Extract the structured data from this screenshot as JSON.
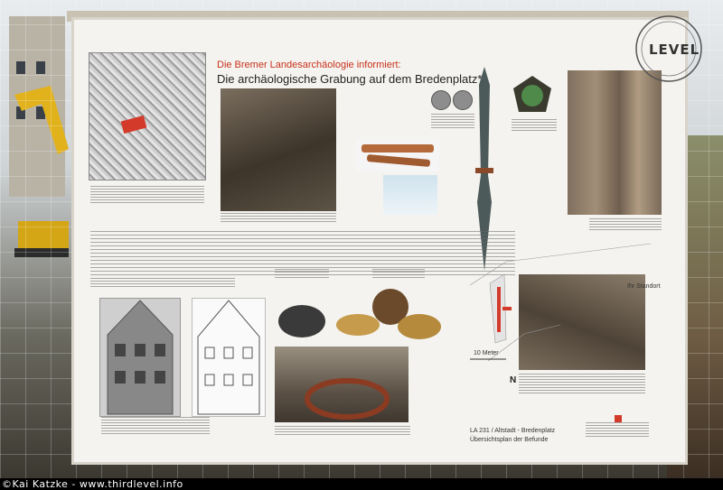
{
  "sign": {
    "title_line1": "Die Bremer Landesarchäologie informiert:",
    "title_line2": "Die archäologische Grabung auf dem Bredenplatz*",
    "plan_label_standort": "Ihr Standort",
    "plan_label_meters": "10 Meter",
    "compass_letter": "N",
    "plan_caption_line1": "LA 231 / Altstadt - Bredenplatz",
    "plan_caption_line2": "Übersichtsplan der Befunde"
  },
  "logo": {
    "text": "LEVEL"
  },
  "credit": "©Kai Katzke - www.thirdlevel.info",
  "colors": {
    "sign_bg": "#f4f3ef",
    "title_red": "#c8321c",
    "plan_red": "#d33a2a"
  }
}
